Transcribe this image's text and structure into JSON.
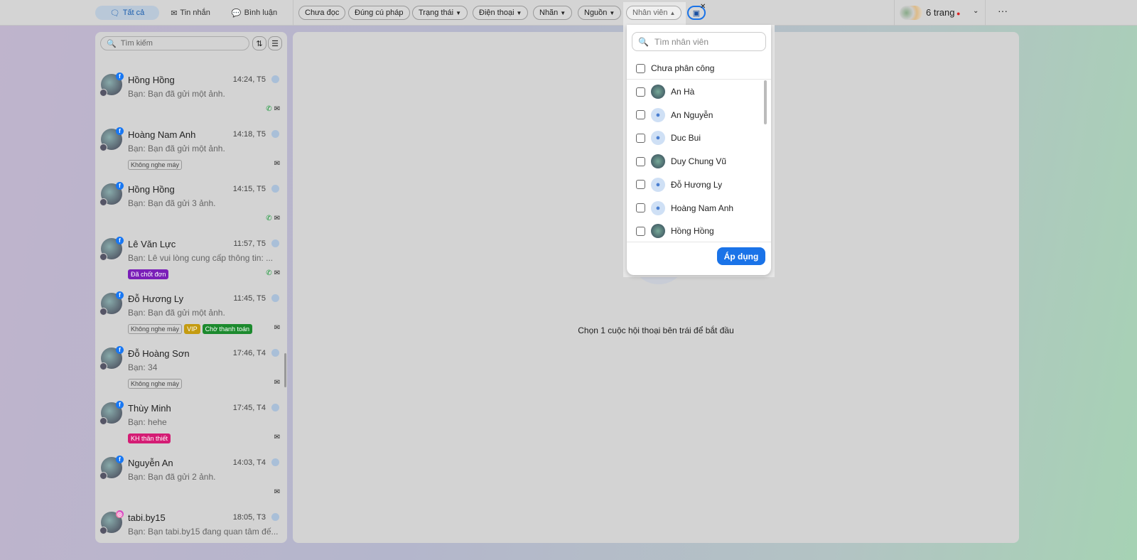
{
  "topbar": {
    "tabs": [
      {
        "label": "Tất cả",
        "icon": "chat-icon"
      },
      {
        "label": "Tin nhắn",
        "icon": "mail-icon"
      },
      {
        "label": "Bình luận",
        "icon": "comment-icon"
      }
    ],
    "filters": [
      "Chưa đọc",
      "Đúng cú pháp",
      "Trạng thái",
      "Điện thoại",
      "Nhãn",
      "Nguồn",
      "Nhân viên"
    ],
    "pages_label": "6 trang"
  },
  "sidebar": {
    "search_placeholder": "Tìm kiếm",
    "conversations": [
      {
        "name": "Hồng Hồng",
        "time": "14:24, T5",
        "message": "Bạn: Bạn đã gửi một ảnh.",
        "tags": [],
        "phone": true,
        "source": "facebook"
      },
      {
        "name": "Hoàng Nam Anh",
        "time": "14:18, T5",
        "message": "Bạn: Bạn đã gửi một ảnh.",
        "tags": [
          {
            "label": "Không nghe máy",
            "style": "outline"
          }
        ],
        "phone": false,
        "source": "facebook"
      },
      {
        "name": "Hồng Hồng",
        "time": "14:15, T5",
        "message": "Bạn: Bạn đã gửi 3 ảnh.",
        "tags": [],
        "phone": true,
        "source": "facebook"
      },
      {
        "name": "Lê Văn Lực",
        "time": "11:57, T5",
        "message": "Bạn: Lê vui lòng cung cấp thông tin: ...",
        "tags": [
          {
            "label": "Đã chốt đơn",
            "style": "purple"
          }
        ],
        "phone": true,
        "source": "facebook"
      },
      {
        "name": "Đỗ Hương Ly",
        "time": "11:45, T5",
        "message": "Bạn: Bạn đã gửi một ảnh.",
        "tags": [
          {
            "label": "Không nghe máy",
            "style": "outline"
          },
          {
            "label": "VIP",
            "style": "gold"
          },
          {
            "label": "Chờ thanh toán",
            "style": "green"
          }
        ],
        "phone": false,
        "source": "facebook"
      },
      {
        "name": "Đỗ Hoàng Sơn",
        "time": "17:46, T4",
        "message": "Bạn: 34",
        "tags": [
          {
            "label": "Không nghe máy",
            "style": "outline"
          }
        ],
        "phone": false,
        "source": "facebook"
      },
      {
        "name": "Thùy Minh",
        "time": "17:45, T4",
        "message": "Bạn: hehe",
        "tags": [
          {
            "label": "KH thân thiết",
            "style": "pink"
          }
        ],
        "phone": false,
        "source": "facebook"
      },
      {
        "name": "Nguyễn An",
        "time": "14:03, T4",
        "message": "Bạn: Bạn đã gửi 2 ảnh.",
        "tags": [],
        "phone": false,
        "source": "facebook"
      },
      {
        "name": "tabi.by15",
        "time": "18:05, T3",
        "message": "Bạn: Bạn tabi.by15 đang quan tâm đế...",
        "tags": [],
        "phone": false,
        "source": "instagram"
      }
    ]
  },
  "main": {
    "empty_text": "Chọn 1 cuộc hội thoại bên trái để bắt đầu"
  },
  "staff_dropdown": {
    "search_placeholder": "Tìm nhân viên",
    "unassigned_label": "Chưa phân công",
    "staff": [
      "An Hà",
      "An Nguyễn",
      "Duc Bui",
      "Duy Chung Vũ",
      "Đỗ Hương Ly",
      "Hoàng Nam Anh",
      "Hồng Hồng"
    ],
    "apply_label": "Áp dụng"
  }
}
